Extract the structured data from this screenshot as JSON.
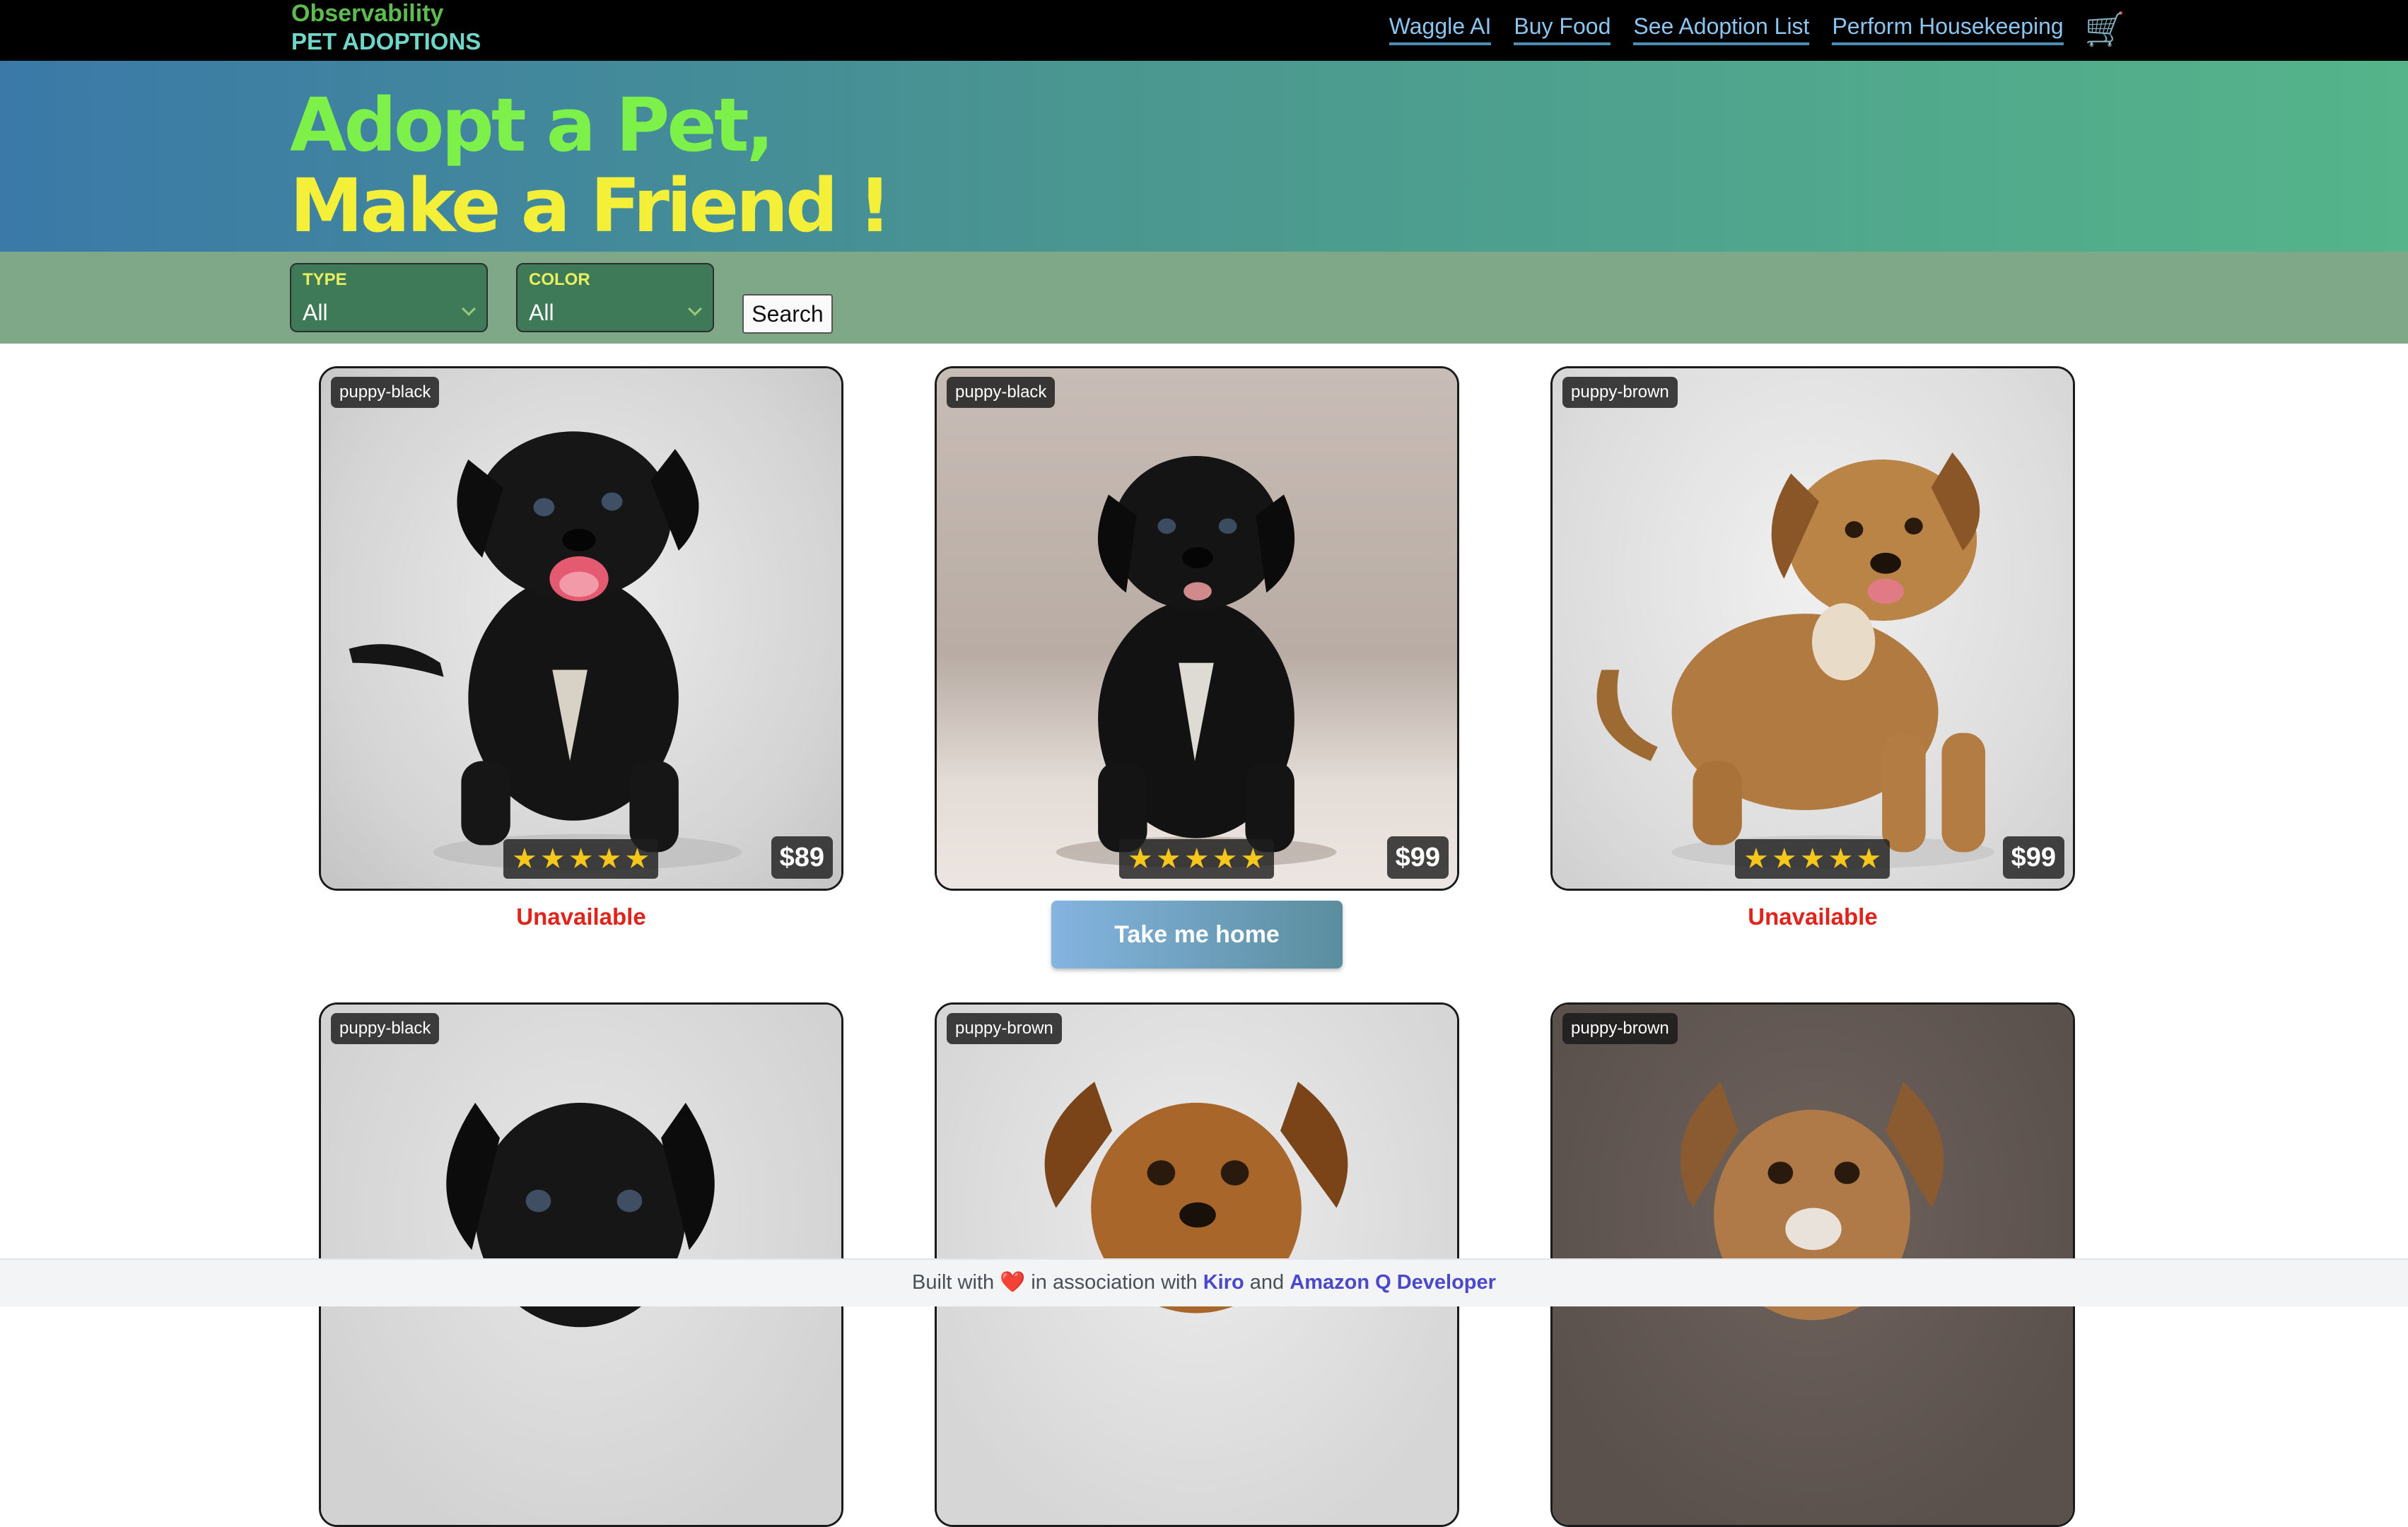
{
  "brand": {
    "line1": "Observability",
    "line2": "PET ADOPTIONS"
  },
  "nav": {
    "links": [
      "Waggle AI",
      "Buy Food",
      "See Adoption List",
      "Perform Housekeeping"
    ],
    "cart_icon": "🛒"
  },
  "hero": {
    "line1": "Adopt a Pet,",
    "line2": "Make a Friend !"
  },
  "filters": {
    "type_label": "TYPE",
    "type_value": "All",
    "color_label": "COLOR",
    "color_value": "All",
    "search_label": "Search"
  },
  "pets": [
    {
      "tag": "puppy-black",
      "price": "$89",
      "rating": 5,
      "action": "Unavailable"
    },
    {
      "tag": "puppy-black",
      "price": "$99",
      "rating": 5,
      "action": "Take me home"
    },
    {
      "tag": "puppy-brown",
      "price": "$99",
      "rating": 5,
      "action": "Unavailable"
    },
    {
      "tag": "puppy-black"
    },
    {
      "tag": "puppy-brown"
    },
    {
      "tag": "puppy-brown"
    }
  ],
  "footer": {
    "prefix": "Built with",
    "heart": "❤️",
    "middle": "in association with",
    "link1": "Kiro",
    "and": "and",
    "link2": "Amazon Q Developer"
  },
  "colors": {
    "topbar": "#000000",
    "brand_green": "#5dbb4f",
    "brand_teal": "#6fd6c8",
    "nav_link": "#8cc4f0",
    "hero_gradient_start": "#3a79a8",
    "hero_gradient_end": "#55b48a",
    "hero_line1": "#7ef04a",
    "hero_line2": "#f4f03a",
    "filter_bar": "#7fa888",
    "unavailable": "#e0241c",
    "star": "#f5c61c",
    "footer_link": "#4b48c9"
  }
}
